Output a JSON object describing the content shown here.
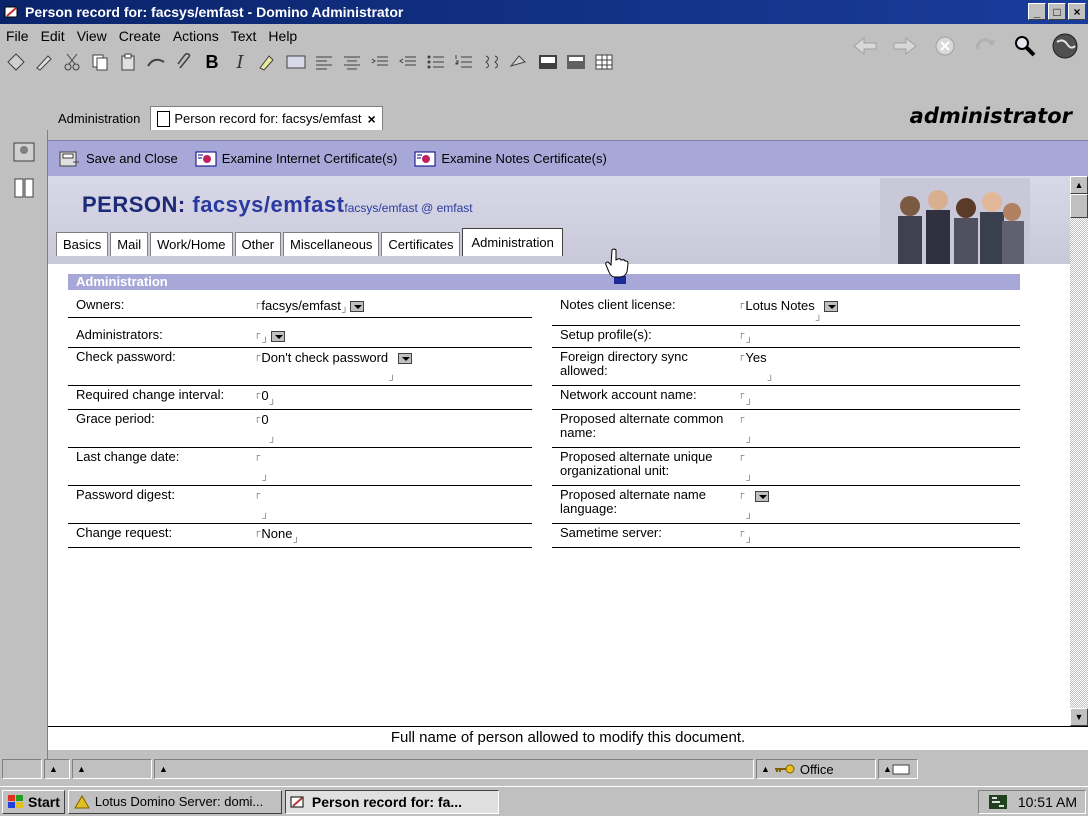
{
  "window": {
    "title": "Person record for: facsys/emfast - Domino Administrator",
    "buttons": [
      "_",
      "□",
      "×"
    ]
  },
  "menu": [
    "File",
    "Edit",
    "View",
    "Create",
    "Actions",
    "Text",
    "Help"
  ],
  "toolbar": {
    "bold_label": "B",
    "italic_label": "I"
  },
  "tabs": {
    "admin_label": "Administration",
    "doc_label": "Person record for: facsys/emfast",
    "close": "×"
  },
  "user": "administrator",
  "actions": {
    "save_close": "Save and Close",
    "examine_internet": "Examine Internet Certificate(s)",
    "examine_notes": "Examine Notes Certificate(s)"
  },
  "person": {
    "label": "PERSON",
    "name": "facsys/emfast",
    "sub": "facsys/emfast @ emfast"
  },
  "doc_tabs": [
    "Basics",
    "Mail",
    "Work/Home",
    "Other",
    "Miscellaneous",
    "Certificates",
    "Administration"
  ],
  "section": "Administration",
  "left_fields": [
    {
      "label": "Owners:",
      "value": "facsys/emfast",
      "dropdown": true
    },
    {
      "label": "Administrators:",
      "value": "",
      "dropdown": true
    },
    {
      "label": "Check password:",
      "value": "Don't check password",
      "dropdown": true
    },
    {
      "label": "Required change interval:",
      "value": "0",
      "dropdown": false
    },
    {
      "label": "Grace period:",
      "value": "0",
      "dropdown": false
    },
    {
      "label": "Last change date:",
      "value": "",
      "dropdown": false
    },
    {
      "label": "Password digest:",
      "value": "",
      "dropdown": false
    },
    {
      "label": "Change request:",
      "value": "None",
      "dropdown": false
    }
  ],
  "right_fields": [
    {
      "label": "Notes client license:",
      "value": "Lotus Notes",
      "dropdown": true
    },
    {
      "label": "Setup profile(s):",
      "value": "",
      "dropdown": false
    },
    {
      "label": "Foreign directory sync allowed:",
      "value": "Yes",
      "dropdown": false
    },
    {
      "label": "Network account name:",
      "value": "",
      "dropdown": false
    },
    {
      "label": "Proposed alternate common name:",
      "value": "",
      "dropdown": false
    },
    {
      "label": "Proposed alternate unique organizational unit:",
      "value": "",
      "dropdown": false
    },
    {
      "label": "Proposed alternate name language:",
      "value": "",
      "dropdown": true
    },
    {
      "label": "Sametime server:",
      "value": "",
      "dropdown": false
    }
  ],
  "hint": "Full name of person allowed to modify this document.",
  "status": {
    "location": "Office"
  },
  "taskbar": {
    "start": "Start",
    "item1": "Lotus Domino Server: domi...",
    "item2": "Person record for: fa...",
    "clock": "10:51 AM"
  }
}
